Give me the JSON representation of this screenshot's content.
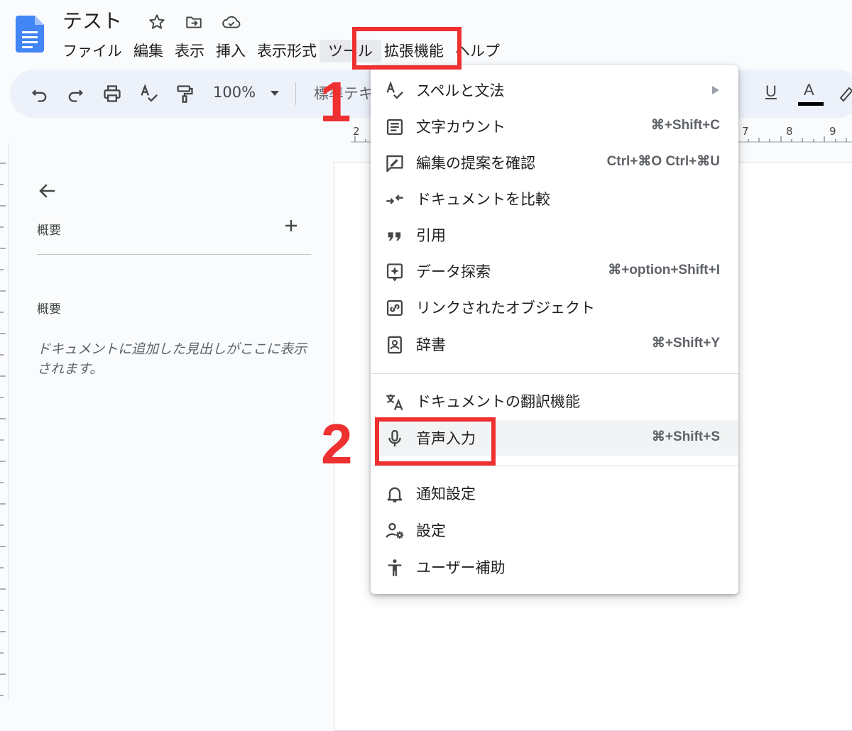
{
  "colors": {
    "accent_blue": "#4285f4",
    "annotation_red": "#ef3030",
    "toolbar_bg": "#edf2fa",
    "menu_highlight": "#f1f3f4"
  },
  "document": {
    "title": "テスト"
  },
  "header_icons": [
    "star-icon",
    "move-to-folder-icon",
    "cloud-saved-icon"
  ],
  "menubar": [
    "ファイル",
    "編集",
    "表示",
    "挿入",
    "表示形式",
    "ツール",
    "拡張機能",
    "ヘルプ"
  ],
  "menubar_active": "ツール",
  "toolbar": {
    "zoom": "100%",
    "style": "標準テキ"
  },
  "ruler": {
    "numbers": [
      "2",
      "7",
      "8",
      "9"
    ]
  },
  "outline": {
    "heading": "概要",
    "summary_label": "概要",
    "empty_text": "ドキュメントに追加した見出しがここに表示されます。"
  },
  "tools_menu": {
    "items": [
      {
        "icon": "spellcheck-icon",
        "label": "スペルと文法",
        "shortcut": "",
        "submenu": true
      },
      {
        "icon": "word-count-icon",
        "label": "文字カウント",
        "shortcut": "⌘+Shift+C"
      },
      {
        "icon": "review-edits-icon",
        "label": "編集の提案を確認",
        "shortcut": "Ctrl+⌘O Ctrl+⌘U"
      },
      {
        "icon": "compare-icon",
        "label": "ドキュメントを比較",
        "shortcut": ""
      },
      {
        "icon": "quote-icon",
        "label": "引用",
        "shortcut": ""
      },
      {
        "icon": "explore-icon",
        "label": "データ探索",
        "shortcut": "⌘+option+Shift+I"
      },
      {
        "icon": "linked-objects-icon",
        "label": "リンクされたオブジェクト",
        "shortcut": ""
      },
      {
        "icon": "dictionary-icon",
        "label": "辞書",
        "shortcut": "⌘+Shift+Y"
      },
      {
        "icon": "translate-icon",
        "label": "ドキュメントの翻訳機能",
        "shortcut": ""
      },
      {
        "icon": "microphone-icon",
        "label": "音声入力",
        "shortcut": "⌘+Shift+S"
      },
      {
        "icon": "bell-icon",
        "label": "通知設定",
        "shortcut": ""
      },
      {
        "icon": "user-settings-icon",
        "label": "設定",
        "shortcut": ""
      },
      {
        "icon": "accessibility-icon",
        "label": "ユーザー補助",
        "shortcut": ""
      }
    ]
  },
  "annotations": {
    "step1": "1",
    "step2": "2"
  }
}
